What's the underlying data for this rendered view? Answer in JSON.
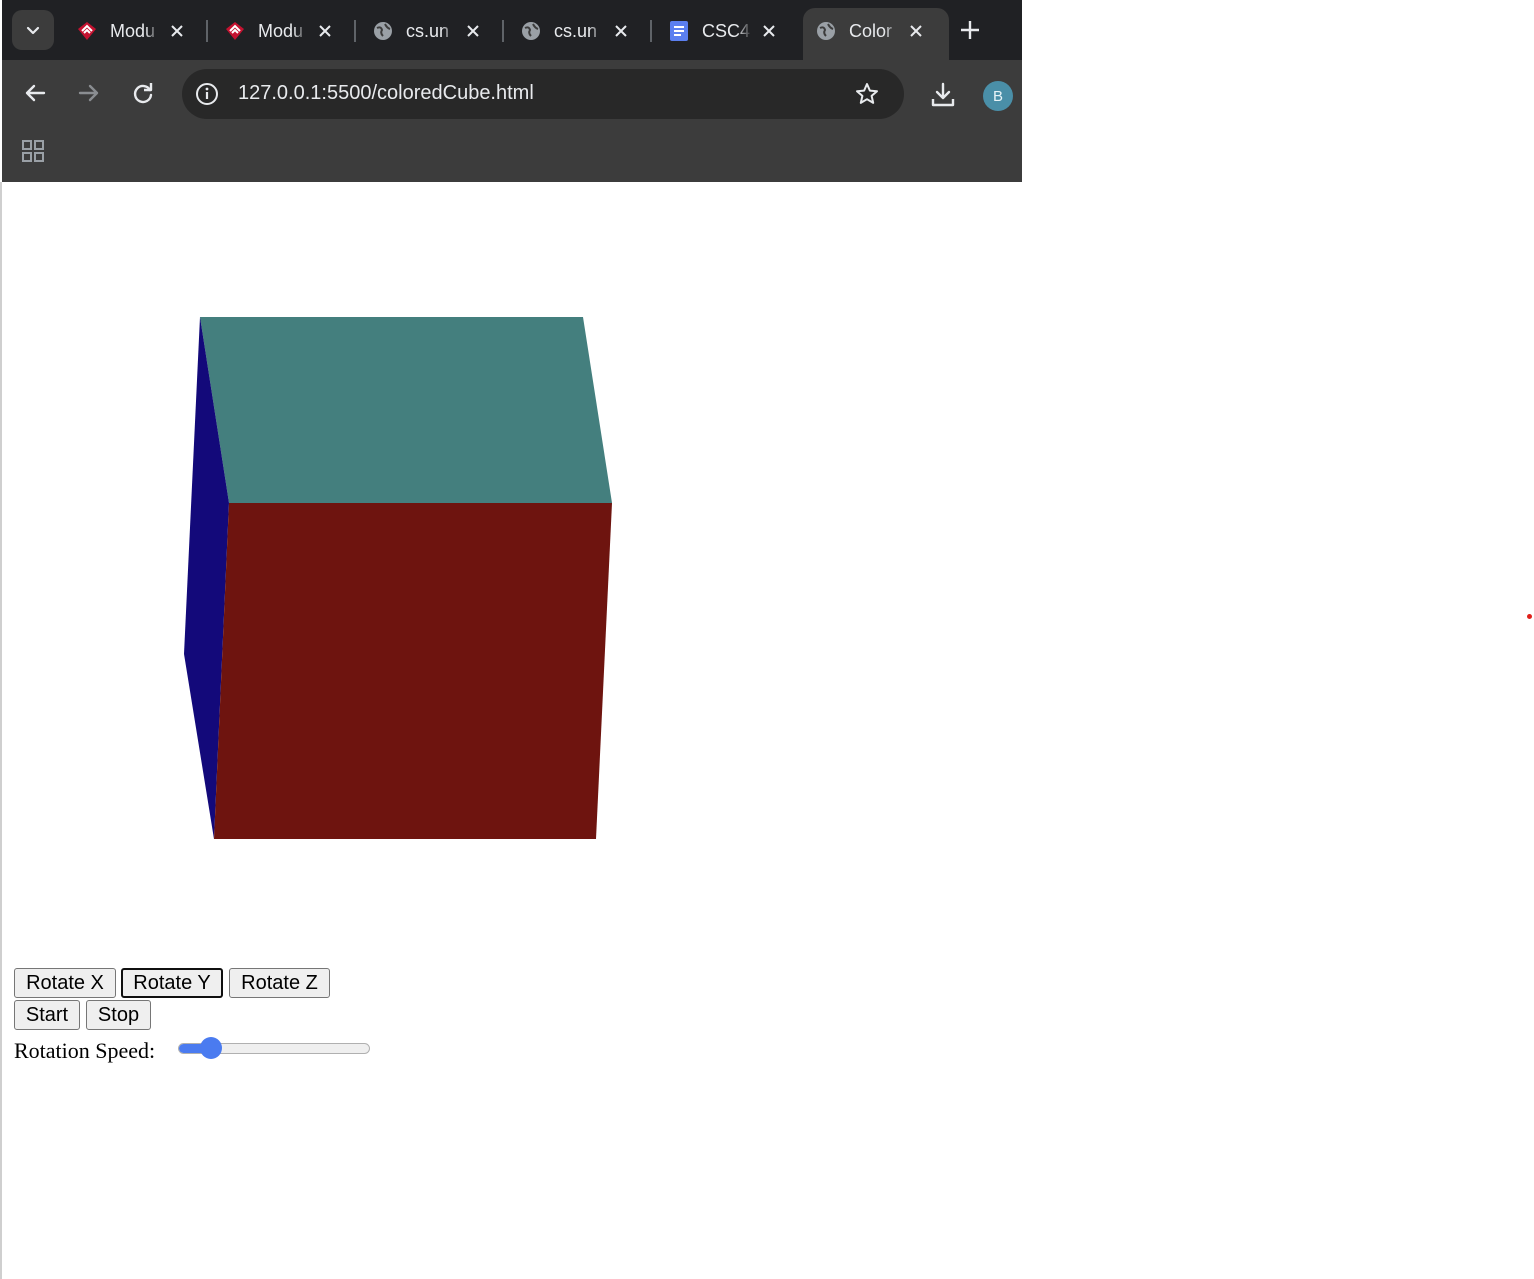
{
  "browser": {
    "tabs": [
      {
        "title": "Modu",
        "favicon": "canvas-logo-icon",
        "active": false
      },
      {
        "title": "Modu",
        "favicon": "canvas-logo-icon",
        "active": false
      },
      {
        "title": "cs.un",
        "favicon": "globe-icon",
        "active": false
      },
      {
        "title": "cs.un",
        "favicon": "globe-icon",
        "active": false
      },
      {
        "title": "CSC4",
        "favicon": "docs-icon",
        "active": false
      },
      {
        "title": "Color",
        "favicon": "globe-icon",
        "active": true
      }
    ],
    "url": {
      "host": "127.0.0.1",
      "rest": ":5500/coloredCube.html"
    },
    "profile_initial": "B",
    "colors": {
      "frame": "#202124",
      "toolbar": "#3c3c3c",
      "omnibox": "#282828",
      "avatar": "#4a8fa8"
    }
  },
  "scene": {
    "faces": [
      {
        "name": "top",
        "color": "#447f7e"
      },
      {
        "name": "front",
        "color": "#6e140f"
      },
      {
        "name": "left",
        "color": "#13097a"
      }
    ]
  },
  "controls": {
    "rotate_x_label": "Rotate X",
    "rotate_y_label": "Rotate Y",
    "rotate_z_label": "Rotate Z",
    "start_label": "Start",
    "stop_label": "Stop",
    "speed_label": "Rotation Speed:",
    "speed_value_fraction": 0.13,
    "focused": "Rotate Y"
  }
}
